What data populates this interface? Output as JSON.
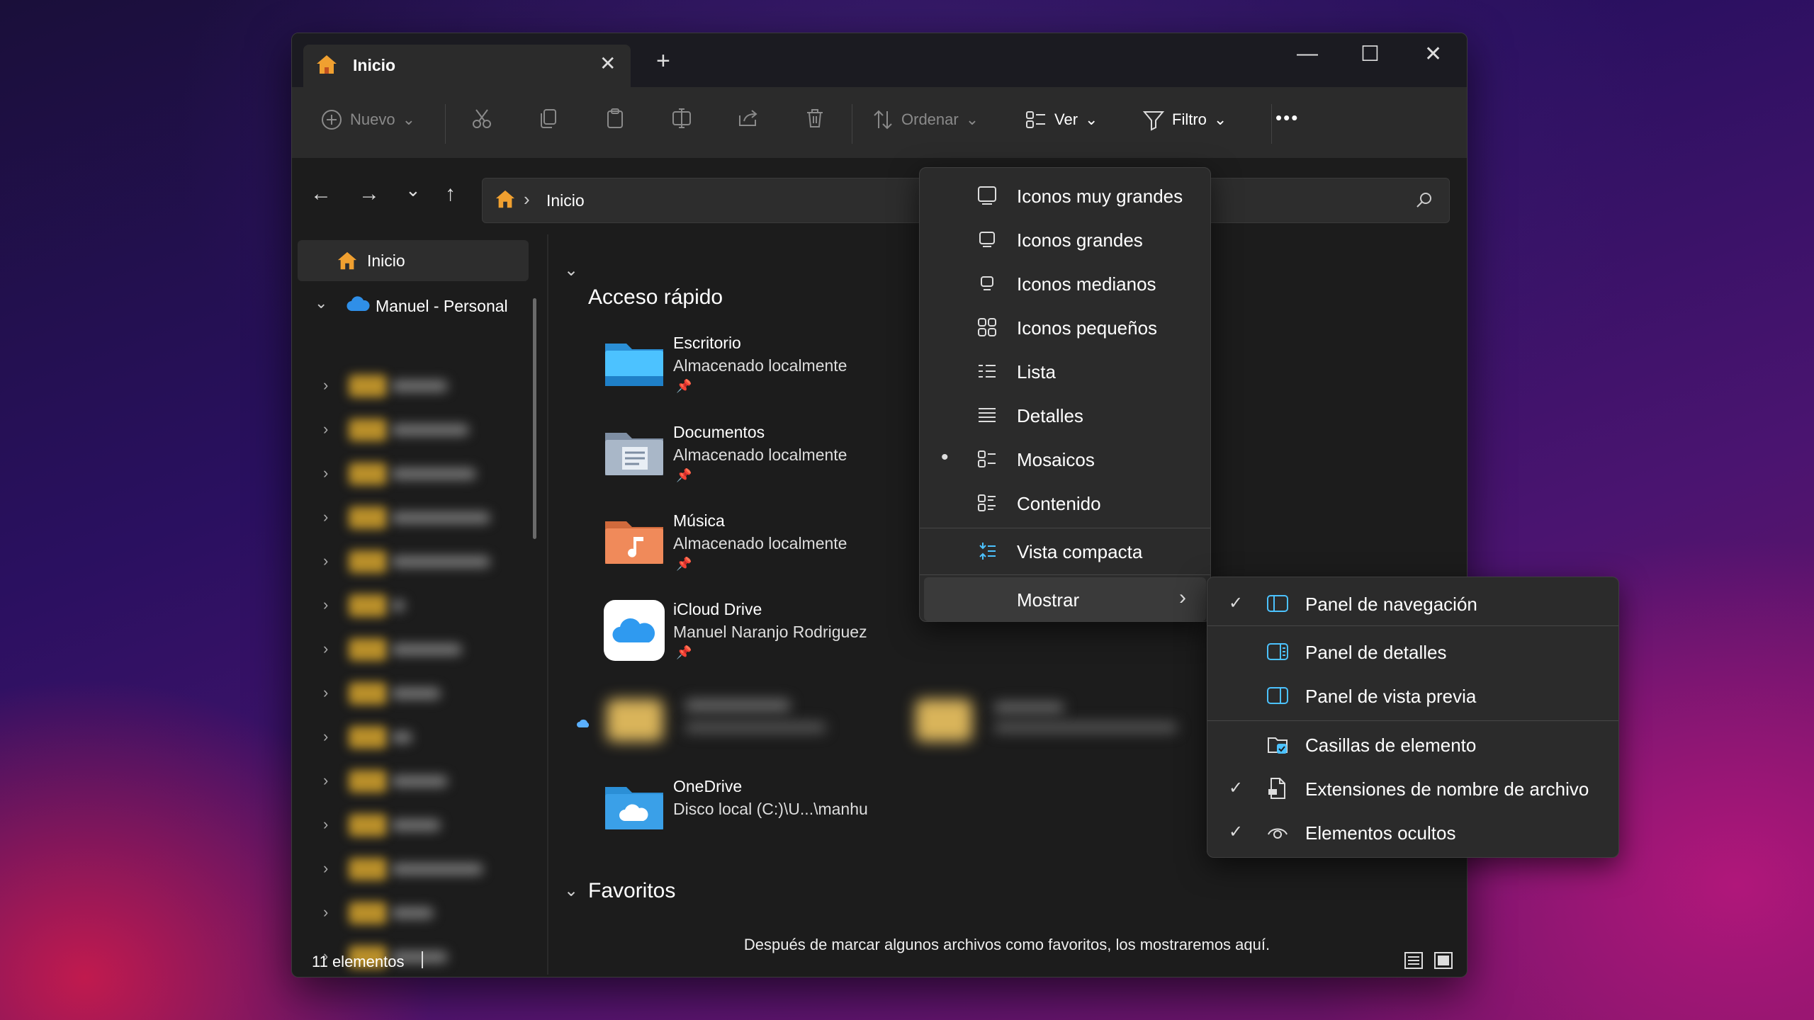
{
  "tab": {
    "title": "Inicio",
    "close_glyph": "✕",
    "new_tab_glyph": "+"
  },
  "window_controls": {
    "minimize": "—",
    "maximize": "☐",
    "close": "✕"
  },
  "toolbar": {
    "new_label": "Nuevo",
    "sort_label": "Ordenar",
    "view_label": "Ver",
    "filter_label": "Filtro",
    "more_label": "•••",
    "caret": "⌄"
  },
  "nav": {
    "back": "←",
    "forward": "→",
    "recent": "⌄",
    "up": "↑",
    "address_sep": "›",
    "address_text": "Inicio"
  },
  "sidebar": {
    "home_label": "Inicio",
    "onedrive_label": "Manuel - Personal"
  },
  "main": {
    "quick_access_header": "Acceso rápido",
    "favorites_header": "Favoritos",
    "favorites_empty": "Después de marcar algunos archivos como favoritos, los mostraremos aquí.",
    "items": [
      {
        "title": "Escritorio",
        "subtitle": "Almacenado localmente"
      },
      {
        "title": "Documentos",
        "subtitle": "Almacenado localmente"
      },
      {
        "title": "Música",
        "subtitle": "Almacenado localmente"
      },
      {
        "title": "iCloud Drive",
        "subtitle": "Manuel Naranjo Rodriguez"
      },
      {
        "title": "OneDrive",
        "subtitle": "Disco local (C:)\\U...\\manhu"
      }
    ]
  },
  "status": {
    "count_label": "11 elementos"
  },
  "view_menu": {
    "items": [
      {
        "label": "Iconos muy grandes",
        "icon": "monitor-icon"
      },
      {
        "label": "Iconos grandes",
        "icon": "monitor-icon"
      },
      {
        "label": "Iconos medianos",
        "icon": "monitor-icon"
      },
      {
        "label": "Iconos pequeños",
        "icon": "grid-icon"
      },
      {
        "label": "Lista",
        "icon": "list-icon"
      },
      {
        "label": "Detalles",
        "icon": "details-icon"
      },
      {
        "label": "Mosaicos",
        "icon": "tiles-icon"
      },
      {
        "label": "Contenido",
        "icon": "content-icon"
      },
      {
        "label": "Vista compacta",
        "icon": "compact-icon"
      },
      {
        "label": "Mostrar",
        "icon": ""
      }
    ],
    "selected": "Mosaicos",
    "selected_bullet": "•",
    "submenu_arrow": "›"
  },
  "show_submenu": {
    "items": [
      {
        "label": "Panel de navegación",
        "checked": true,
        "icon": "navigation-pane-icon"
      },
      {
        "label": "Panel de detalles",
        "checked": false,
        "icon": "details-pane-icon"
      },
      {
        "label": "Panel de vista previa",
        "checked": false,
        "icon": "preview-pane-icon"
      },
      {
        "label": "Casillas de elemento",
        "checked": false,
        "icon": "checkbox-icon"
      },
      {
        "label": "Extensiones de nombre de archivo",
        "checked": true,
        "icon": "file-extension-icon"
      },
      {
        "label": "Elementos ocultos",
        "checked": true,
        "icon": "hidden-items-icon"
      }
    ],
    "check_glyph": "✓"
  },
  "colors": {
    "accent": "#4cc2ff",
    "folder_blue": "#3aa0e8",
    "home_orange": "#f0a030"
  }
}
